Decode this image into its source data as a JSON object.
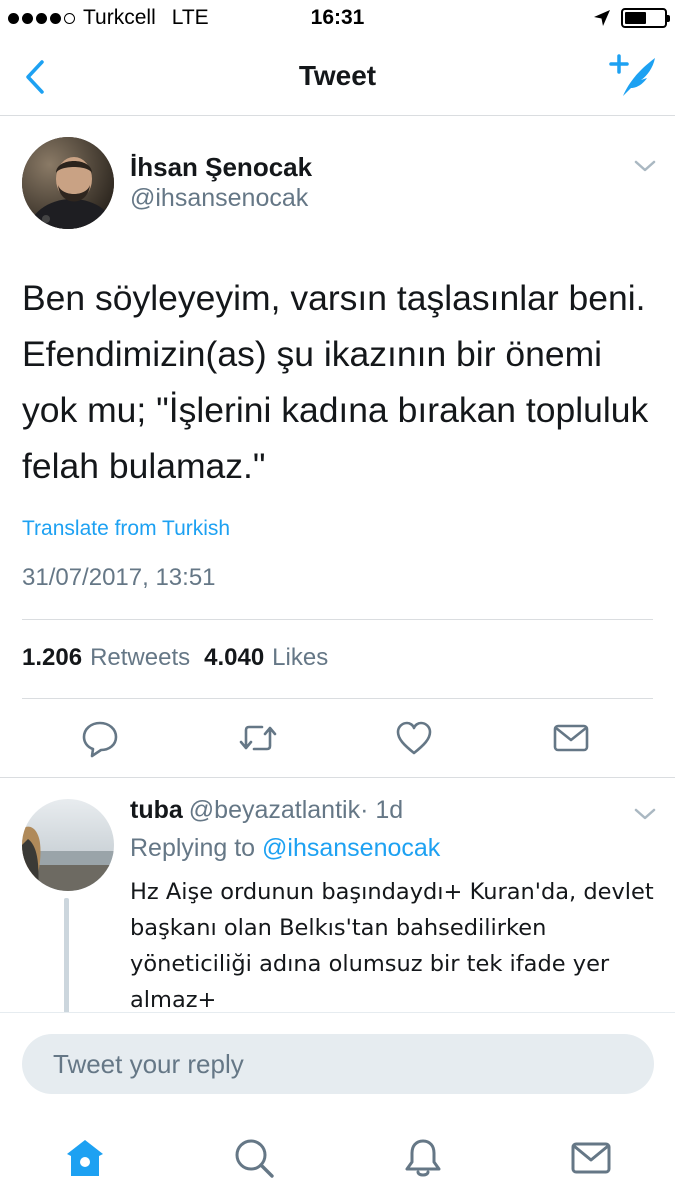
{
  "status_bar": {
    "carrier": "Turkcell",
    "network": "LTE",
    "time": "16:31",
    "signal_bars": 4,
    "battery_level": 0.55
  },
  "nav": {
    "title": "Tweet",
    "back_icon": "chevron-left-icon",
    "compose_icon": "compose-tweet-icon"
  },
  "tweet": {
    "author_name": "İhsan Şenocak",
    "author_handle": "@ihsansenocak",
    "text": "Ben söyleyeyim, varsın taşlasınlar beni. Efendimizin(as) şu ikazının bir önemi yok mu; \"İşlerini kadına bırakan topluluk felah bulamaz.\"",
    "translate_label": "Translate from Turkish",
    "timestamp": "31/07/2017, 13:51",
    "retweets_count": "1.206",
    "retweets_label": "Retweets",
    "likes_count": "4.040",
    "likes_label": "Likes"
  },
  "reply": {
    "author_name": "tuba",
    "author_handle": "@beyazatlantik",
    "time": "· 1d",
    "replying_prefix": "Replying to",
    "replying_mention": "@ihsansenocak",
    "text": "Hz Aişe ordunun başındaydı+ Kuran'da, devlet başkanı olan Belkıs'tan bahsedilirken yöneticiliği adına olumsuz bir tek ifade yer almaz+"
  },
  "composer": {
    "placeholder": "Tweet your reply"
  },
  "colors": {
    "accent": "#1da1f2",
    "secondary_text": "#657786",
    "action_icon": "#657786"
  }
}
